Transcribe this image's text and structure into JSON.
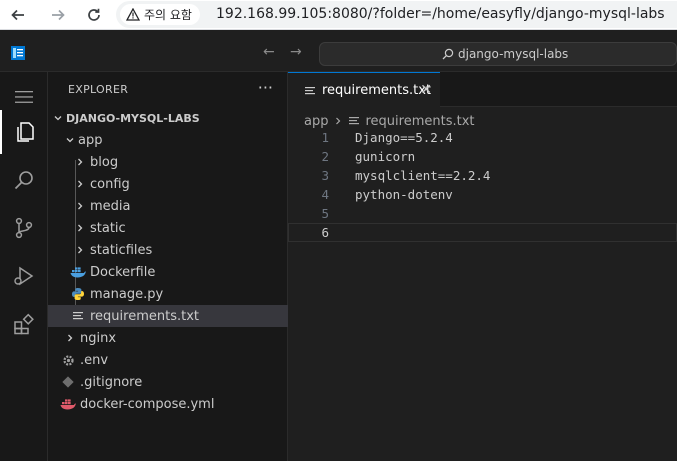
{
  "browser": {
    "security_label": "주의 요함",
    "url": "192.168.99.105:8080/?folder=/home/easyfly/django-mysql-labs"
  },
  "titlebar": {
    "search_label": "django-mysql-labs"
  },
  "activity_bar": {
    "items": [
      "explorer-icon",
      "search-icon",
      "source-control-icon",
      "run-debug-icon",
      "extensions-icon"
    ]
  },
  "sidebar": {
    "title": "EXPLORER",
    "more": "···",
    "project": "DJANGO-MYSQL-LABS",
    "tree": [
      {
        "label": "app",
        "type": "folder-open",
        "depth": 1
      },
      {
        "label": "blog",
        "type": "folder",
        "depth": 2
      },
      {
        "label": "config",
        "type": "folder",
        "depth": 2
      },
      {
        "label": "media",
        "type": "folder",
        "depth": 2
      },
      {
        "label": "static",
        "type": "folder",
        "depth": 2
      },
      {
        "label": "staticfiles",
        "type": "folder",
        "depth": 2
      },
      {
        "label": "Dockerfile",
        "type": "docker",
        "depth": 2
      },
      {
        "label": "manage.py",
        "type": "python",
        "depth": 2
      },
      {
        "label": "requirements.txt",
        "type": "text",
        "depth": 2,
        "selected": true
      },
      {
        "label": "nginx",
        "type": "folder",
        "depth": 1
      },
      {
        "label": ".env",
        "type": "gear",
        "depth": 1
      },
      {
        "label": ".gitignore",
        "type": "git",
        "depth": 1
      },
      {
        "label": "docker-compose.yml",
        "type": "docker",
        "depth": 1
      }
    ]
  },
  "editor": {
    "tab_label": "requirements.txt",
    "breadcrumbs": [
      "app",
      "requirements.txt"
    ],
    "lines": [
      {
        "num": "1",
        "text": "Django==5.2.4"
      },
      {
        "num": "2",
        "text": "gunicorn"
      },
      {
        "num": "3",
        "text": "mysqlclient==2.2.4"
      },
      {
        "num": "4",
        "text": "python-dotenv"
      },
      {
        "num": "5",
        "text": ""
      },
      {
        "num": "6",
        "text": ""
      }
    ],
    "current_line": 6
  },
  "colors": {
    "accent": "#0078d4",
    "docker": "#4a9fe0",
    "python": "#4b8bbe",
    "git": "#7a7a7a"
  }
}
